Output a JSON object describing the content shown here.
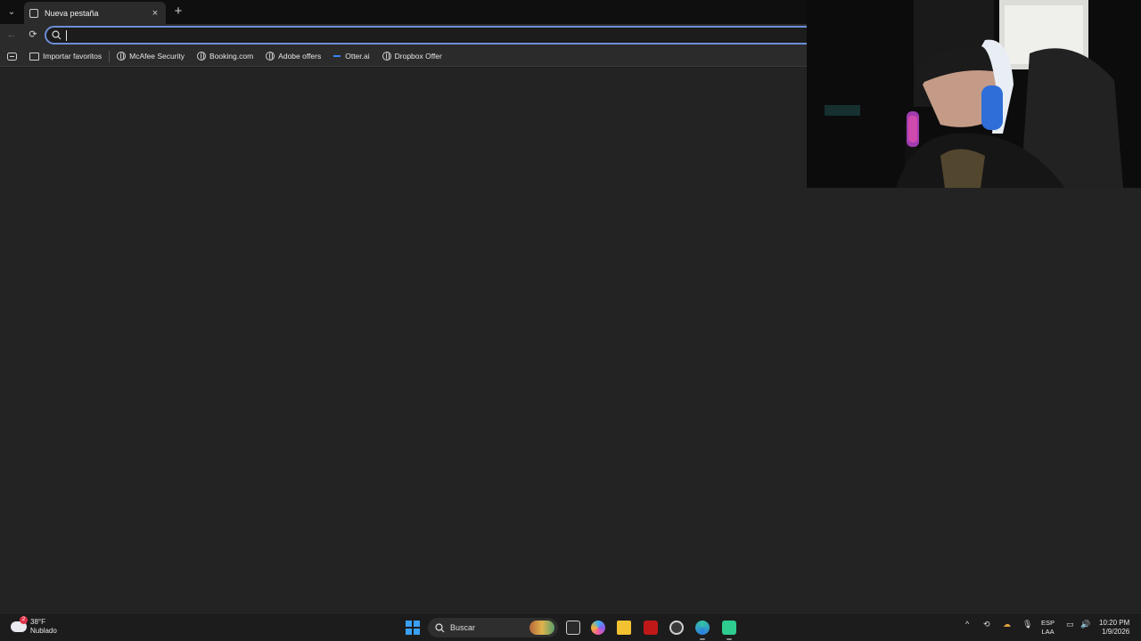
{
  "browser": {
    "tab": {
      "title": "Nueva pestaña",
      "close": "×"
    },
    "new_tab": "+",
    "tab_menu": "⌄",
    "toolbar": {
      "back": "←",
      "reload": "⟳",
      "omnibox_value": "",
      "omnibox_icon": "search-icon"
    },
    "bookmarks": [
      {
        "label": "Importar favoritos",
        "icon": "folder-icon"
      },
      {
        "label": "McAfee Security",
        "icon": "globe-icon"
      },
      {
        "label": "Booking.com",
        "icon": "globe-icon"
      },
      {
        "label": "Adobe offers",
        "icon": "globe-icon"
      },
      {
        "label": "Otter.ai",
        "icon": "otter-icon"
      },
      {
        "label": "Dropbox Offer",
        "icon": "globe-icon"
      }
    ]
  },
  "taskbar": {
    "weather": {
      "temp": "38°F",
      "condition": "Nublado",
      "badge": "2"
    },
    "search_label": "Buscar",
    "tray": {
      "lang_top": "ESP",
      "lang_bottom": "LAA",
      "time": "10:20 PM",
      "date": "1/9/2026"
    }
  },
  "colors": {
    "accent": "#6d8ed8",
    "start": "#3aa0f5",
    "mcafee": "#c01818"
  }
}
